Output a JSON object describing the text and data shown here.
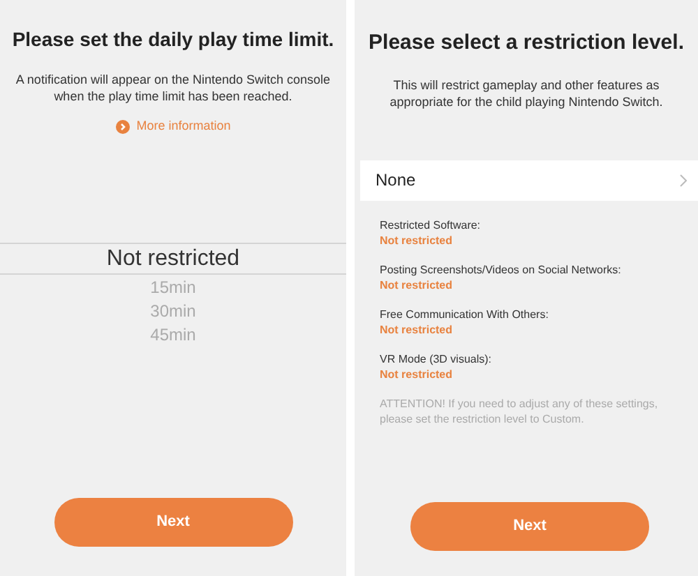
{
  "screens": [
    {
      "kind": "time_limit",
      "title": "Please set the daily play time limit.",
      "description": "A notification will appear on the Nintendo Switch console when the play time limit has been reached.",
      "link": "More information",
      "picker": [
        {
          "label": "Not restricted",
          "selected": true
        },
        {
          "label": "15min",
          "selected": false
        },
        {
          "label": "30min",
          "selected": false
        },
        {
          "label": "45min",
          "selected": false
        }
      ],
      "button": "Next"
    },
    {
      "kind": "restriction_level",
      "title": "Please select a restriction level.",
      "description": "This will restrict gameplay and other features as appropriate for the child playing Nintendo Switch.",
      "level": "None",
      "settings": [
        {
          "label": "Restricted Software:",
          "value": "Not restricted"
        },
        {
          "label": "Posting Screenshots/Videos on Social Networks:",
          "value": "Not restricted"
        },
        {
          "label": "Free Communication With Others:",
          "value": "Not restricted"
        },
        {
          "label": "VR Mode (3D visuals):",
          "value": "Not restricted"
        }
      ],
      "note": "ATTENTION! If you need to adjust any of these settings, please set the restriction level to Custom.",
      "button": "Next"
    }
  ]
}
